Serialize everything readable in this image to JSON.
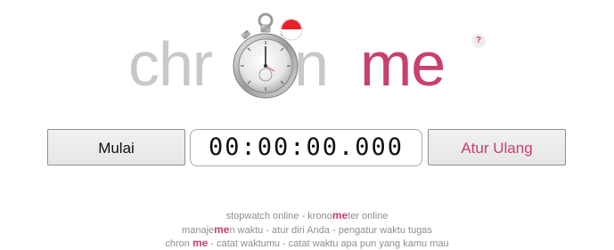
{
  "logo": {
    "part1": "chr",
    "part2": "n",
    "part3": "me",
    "help_label": "?"
  },
  "controls": {
    "start_label": "Mulai",
    "timer_value": "00:00:00.000",
    "reset_label": "Atur Ulang"
  },
  "footer": {
    "line1": {
      "a": "stopwatch online - krono",
      "hl": "me",
      "b": "ter online"
    },
    "line2": {
      "a": "manaje",
      "hl": "me",
      "b": "n waktu - atur diri Anda - pengatur waktu tugas"
    },
    "line3": {
      "a": "chron ",
      "hl": "me",
      "b": " - catat waktumu - catat waktu apa pun yang kamu mau"
    }
  },
  "colors": {
    "accent": "#c9406c",
    "logo_grey": "#c9c7c7",
    "footer_text": "#8e8e8e",
    "flag_red": "#e8202a",
    "flag_white": "#ffffff"
  },
  "icons": {
    "stopwatch": "stopwatch-icon",
    "flag": "indonesia-flag-icon",
    "help": "help-icon"
  }
}
